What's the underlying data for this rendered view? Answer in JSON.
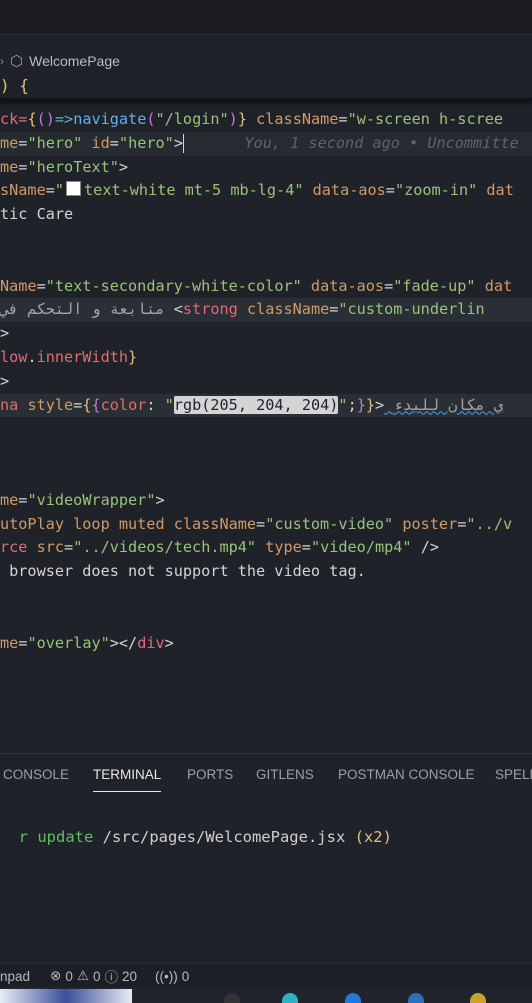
{
  "breadcrumb": {
    "chevron": "›",
    "icon": "cube-icon",
    "label": "WelcomePage"
  },
  "sticky": {
    "text": ") {"
  },
  "code_lines": [
    {
      "parts": [
        [
          "k-red",
          "ck="
        ],
        [
          "k-yellow",
          "{"
        ],
        [
          "k-purple",
          "()"
        ],
        [
          "k-cyan",
          "=>"
        ],
        [
          "k-blue",
          "navigate"
        ],
        [
          "k-purple",
          "("
        ],
        [
          "k-green",
          "\"/login\""
        ],
        [
          "k-purple",
          ")"
        ],
        [
          "k-yellow",
          "}"
        ],
        [
          "k-white",
          " "
        ],
        [
          "k-orange",
          "className"
        ],
        [
          "k-white",
          "="
        ],
        [
          "k-green",
          "\"w-screen h-scree"
        ]
      ]
    },
    {
      "parts": [
        [
          "k-orange",
          "me"
        ],
        [
          "k-white",
          "="
        ],
        [
          "k-green",
          "\"hero\""
        ],
        [
          "k-white",
          " "
        ],
        [
          "k-orange",
          "id"
        ],
        [
          "k-white",
          "="
        ],
        [
          "k-green",
          "\"hero\""
        ],
        [
          "k-white",
          ">"
        ]
      ],
      "cursor": true,
      "blame": "You, 1 second ago • Uncommitte"
    },
    {
      "parts": [
        [
          "k-orange",
          "me"
        ],
        [
          "k-white",
          "="
        ],
        [
          "k-green",
          "\"heroText\""
        ],
        [
          "k-white",
          ">"
        ]
      ]
    },
    {
      "parts": [
        [
          "k-orange",
          "sName"
        ],
        [
          "k-white",
          "="
        ],
        [
          "k-green",
          "\""
        ]
      ],
      "swatch": true,
      "after": [
        [
          "k-green",
          "text-white mt-5 mb-lg-4\""
        ],
        [
          "k-white",
          " "
        ],
        [
          "k-orange",
          "data-aos"
        ],
        [
          "k-white",
          "="
        ],
        [
          "k-green",
          "\"zoom-in\""
        ],
        [
          "k-white",
          " "
        ],
        [
          "k-orange",
          "dat"
        ]
      ]
    },
    {
      "parts": [
        [
          "k-white",
          "tic Care"
        ]
      ]
    },
    {
      "parts": []
    },
    {
      "parts": []
    },
    {
      "parts": [
        [
          "k-orange",
          "Name"
        ],
        [
          "k-white",
          "="
        ],
        [
          "k-green",
          "\"text-secondary-white-color\""
        ],
        [
          "k-white",
          " "
        ],
        [
          "k-orange",
          "data-aos"
        ],
        [
          "k-white",
          "="
        ],
        [
          "k-green",
          "\"fade-up\""
        ],
        [
          "k-white",
          " "
        ],
        [
          "k-orange",
          "dat"
        ]
      ]
    },
    {
      "parts": [
        [
          "arabic",
          "متابعة و التحكم في "
        ],
        [
          "k-white",
          "<"
        ],
        [
          "k-red",
          "strong"
        ],
        [
          "k-white",
          " "
        ],
        [
          "k-orange",
          "className"
        ],
        [
          "k-white",
          "="
        ],
        [
          "k-green",
          "\"custom-underlin"
        ]
      ],
      "hl": true
    },
    {
      "parts": [
        [
          "k-white",
          ">"
        ]
      ]
    },
    {
      "parts": [
        [
          "k-red",
          "low"
        ],
        [
          "k-white",
          "."
        ],
        [
          "k-red",
          "innerWidth"
        ],
        [
          "k-yellow",
          "}"
        ]
      ]
    },
    {
      "parts": [
        [
          "k-white",
          ">"
        ]
      ]
    },
    {
      "parts": [
        [
          "k-red",
          "na"
        ],
        [
          "k-white",
          " "
        ],
        [
          "k-orange",
          "style"
        ],
        [
          "k-white",
          "="
        ],
        [
          "k-yellow",
          "{"
        ],
        [
          "k-purple",
          "{"
        ],
        [
          "k-red",
          "color"
        ],
        [
          "k-white",
          ": "
        ],
        [
          "k-green",
          "\""
        ],
        [
          "sel",
          "rgb(205, 204, 204)"
        ],
        [
          "k-green",
          "\""
        ],
        [
          "k-white",
          ";"
        ],
        [
          "k-purple",
          "}"
        ],
        [
          "k-yellow",
          "}"
        ],
        [
          "k-white",
          ">"
        ],
        [
          "arabic squig",
          " ي مكان للبدء"
        ]
      ],
      "hl": true
    },
    {
      "parts": []
    },
    {
      "parts": []
    },
    {
      "parts": []
    },
    {
      "parts": [
        [
          "k-orange",
          "me"
        ],
        [
          "k-white",
          "="
        ],
        [
          "k-green",
          "\"videoWrapper\""
        ],
        [
          "k-white",
          ">"
        ]
      ]
    },
    {
      "parts": [
        [
          "k-orange",
          "utoPlay loop muted className"
        ],
        [
          "k-white",
          "="
        ],
        [
          "k-green",
          "\"custom-video\""
        ],
        [
          "k-white",
          " "
        ],
        [
          "k-orange",
          "poster"
        ],
        [
          "k-white",
          "="
        ],
        [
          "k-green",
          "\"../v"
        ]
      ]
    },
    {
      "parts": [
        [
          "k-red",
          "rce"
        ],
        [
          "k-white",
          " "
        ],
        [
          "k-orange",
          "src"
        ],
        [
          "k-white",
          "="
        ],
        [
          "k-green",
          "\"../videos/tech.mp4\""
        ],
        [
          "k-white",
          " "
        ],
        [
          "k-orange",
          "type"
        ],
        [
          "k-white",
          "="
        ],
        [
          "k-green",
          "\"video/mp4\""
        ],
        [
          "k-white",
          " />"
        ]
      ]
    },
    {
      "parts": [
        [
          "k-white",
          " browser does not support the video tag."
        ]
      ]
    },
    {
      "parts": []
    },
    {
      "parts": []
    },
    {
      "parts": [
        [
          "k-orange",
          "me"
        ],
        [
          "k-white",
          "="
        ],
        [
          "k-green",
          "\"overlay\""
        ],
        [
          "k-white",
          "></"
        ],
        [
          "k-red",
          "div"
        ],
        [
          "k-white",
          ">"
        ]
      ]
    }
  ],
  "panel": {
    "tabs": [
      {
        "label": "CONSOLE",
        "active": false
      },
      {
        "label": "TERMINAL",
        "active": true
      },
      {
        "label": "PORTS",
        "active": false
      },
      {
        "label": "GITLENS",
        "active": false
      },
      {
        "label": "POSTMAN CONSOLE",
        "active": false
      },
      {
        "label": "SPELL",
        "active": false
      }
    ],
    "terminal": {
      "prefix": "r update ",
      "path": "/src/pages/WelcomePage.jsx",
      "count": " (x2)"
    }
  },
  "status": {
    "left_label": "npad",
    "errors": "0",
    "warnings": "0",
    "info": "20",
    "ports": "0"
  }
}
